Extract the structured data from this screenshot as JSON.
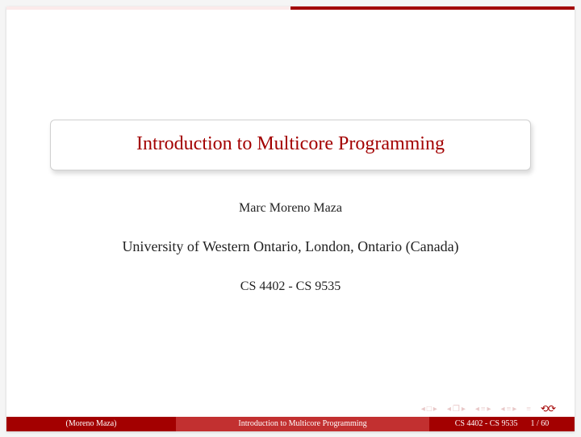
{
  "slide": {
    "title": "Introduction to Multicore Programming",
    "author": "Marc Moreno Maza",
    "affiliation": "University of Western Ontario, London, Ontario (Canada)",
    "course": "CS 4402 - CS 9535"
  },
  "footer": {
    "author_short": "(Moreno Maza)",
    "title_short": "Introduction to Multicore Programming",
    "course_short": "CS 4402 - CS 9535",
    "page": "1 / 60"
  },
  "nav": {
    "back_slide": "◂ □ ▸",
    "back_section": "◂ 🗗 ▸",
    "back_subsection": "◂ ≡ ▸",
    "forward_subsection": "◂ ≡ ▸",
    "presentation": "≡",
    "loop": "⟲ Q ⟳"
  }
}
